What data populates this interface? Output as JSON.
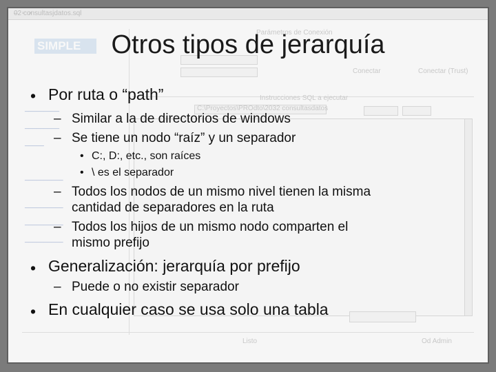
{
  "slide": {
    "title": "Otros tipos de jerarquía",
    "bullets": {
      "b1": "Por ruta o “path”",
      "b1_1": "Similar a la de directorios de windows",
      "b1_2": "Se tiene un nodo “raíz” y un separador",
      "b1_2_1": "C:, D:, etc., son raíces",
      "b1_2_2": "\\ es el separador",
      "b1_3_line1": "Todos los nodos de un mismo nivel tienen la misma",
      "b1_3_line2": "cantidad de separadores en la ruta",
      "b1_4_line1": "Todos los hijos de un mismo nodo comparten el",
      "b1_4_line2": "mismo prefijo",
      "b2": "Generalización: jerarquía por prefijo",
      "b2_1": "Puede o no existir separador",
      "b3": "En cualquier caso se usa solo una tabla"
    },
    "markers": {
      "bullet": "•",
      "dash": "–"
    }
  },
  "background": {
    "window_title": "02 consultasjdatos.sql",
    "logo_text": "SIMPLE",
    "panel_title": "Parámetros de Conexión",
    "connect_btn": "Conectar",
    "connect_trust_btn": "Conectar (Trust)",
    "sql_panel_title": "Instrucciones SQL a ejecutar",
    "path_field": "C:\\Proyectos\\PROdto\\2032 consultasdatos",
    "status_left": "Listo",
    "status_right": "Od Admin"
  }
}
